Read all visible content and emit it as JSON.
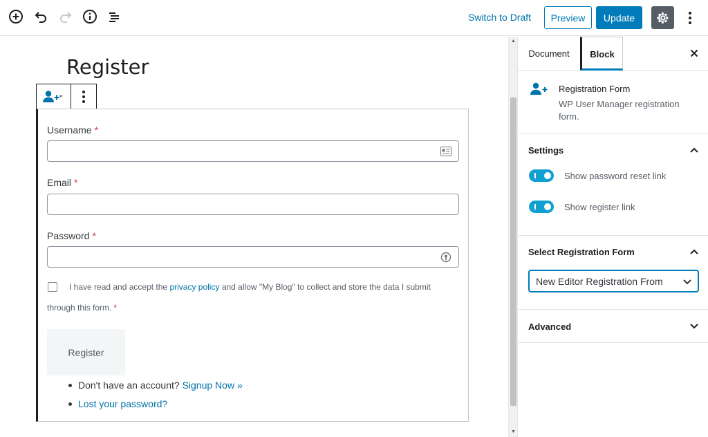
{
  "toolbar": {
    "switch_to_draft": "Switch to Draft",
    "preview": "Preview",
    "update": "Update"
  },
  "editor": {
    "page_title": "Register",
    "form": {
      "username_label": "Username",
      "email_label": "Email",
      "password_label": "Password",
      "required_mark": "*",
      "consent_before": "I have read and accept the",
      "consent_link": "privacy policy",
      "consent_after": "and allow \"My Blog\" to collect and store the data I submit through this form.",
      "register_button": "Register",
      "no_account_text": "Don't have an account?",
      "signup_link": "Signup Now »",
      "lost_password_link": "Lost your password?"
    }
  },
  "sidebar": {
    "tabs": {
      "document": "Document",
      "block": "Block"
    },
    "block_card": {
      "title": "Registration Form",
      "description": "WP User Manager registration form."
    },
    "settings": {
      "title": "Settings",
      "toggles": [
        {
          "label": "Show password reset link",
          "on": true
        },
        {
          "label": "Show register link",
          "on": true
        }
      ]
    },
    "select_form": {
      "title": "Select Registration Form",
      "selected": "New Editor Registration From"
    },
    "advanced": {
      "title": "Advanced"
    }
  },
  "colors": {
    "accent": "#007cba",
    "link": "#0073aa",
    "toggle_on": "#11a0d2",
    "required": "#dc3232",
    "settings_button": "#555d66"
  },
  "icons": {
    "add": "plus-circle-icon",
    "undo": "undo-icon",
    "redo": "redo-icon",
    "info": "info-icon",
    "outline": "list-icon",
    "settings": "gear-icon",
    "more": "more-vertical-icon",
    "block_type": "user-add-icon",
    "close": "close-icon"
  }
}
